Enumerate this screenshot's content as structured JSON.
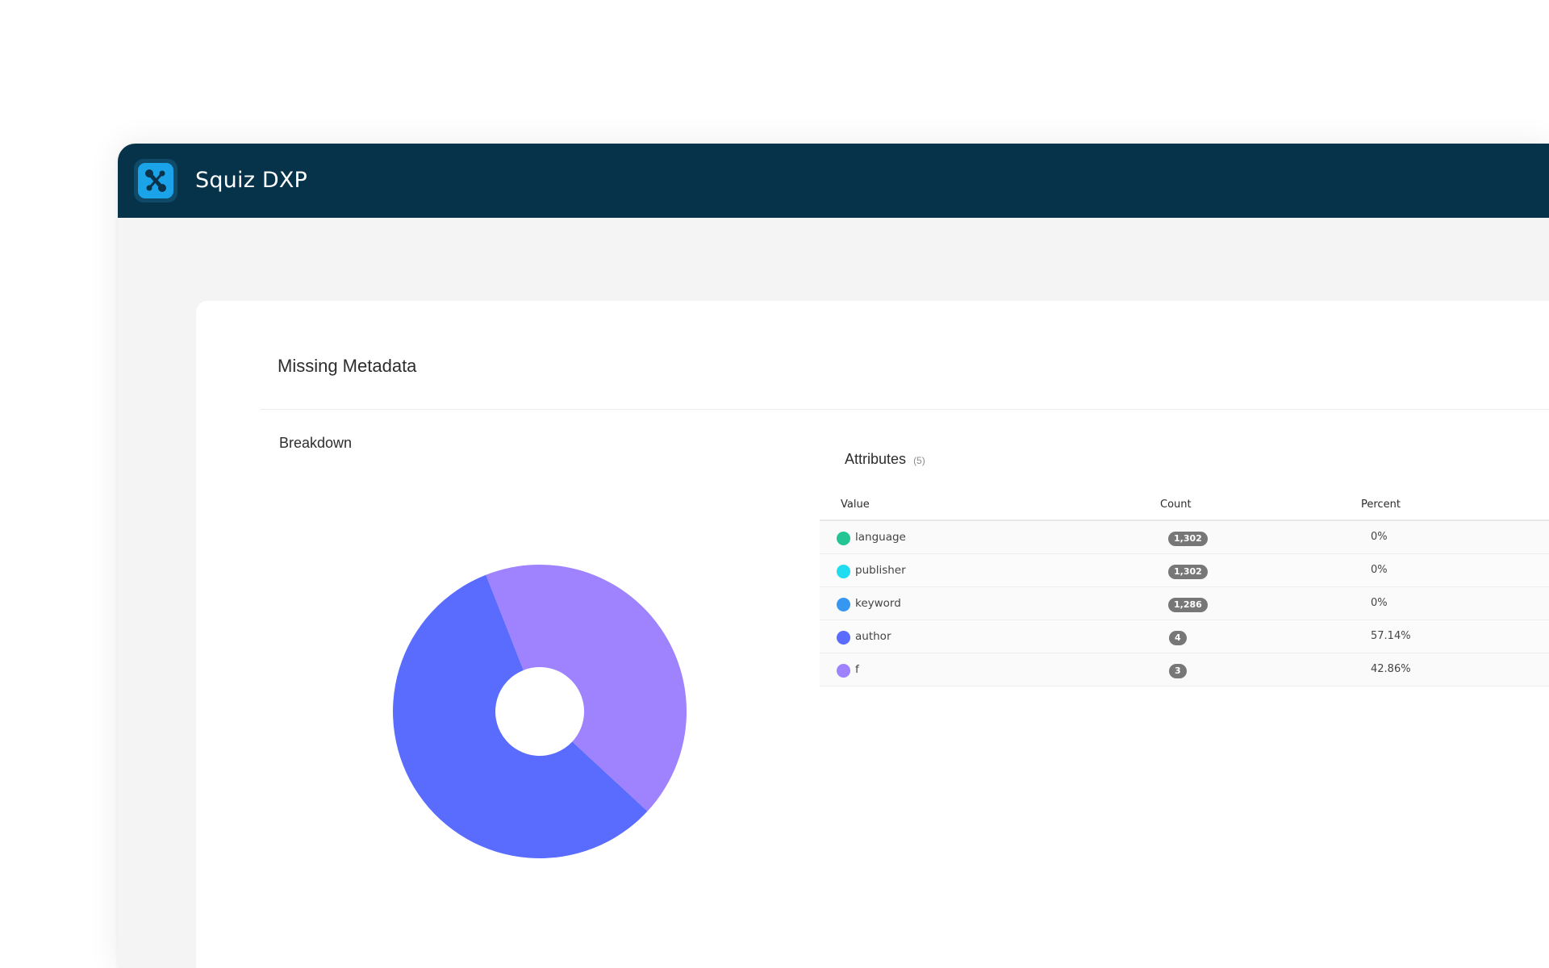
{
  "app": {
    "title": "Squiz DXP"
  },
  "colors": {
    "header_bg": "#063349",
    "logo_blue": "#1ba3ea",
    "logo_dark": "#0a3248"
  },
  "card": {
    "title": "Missing Metadata",
    "breakdown_label": "Breakdown"
  },
  "attributes": {
    "heading": "Attributes",
    "count_label": "(5)",
    "columns": {
      "value": "Value",
      "count": "Count",
      "percent": "Percent"
    },
    "rows": [
      {
        "value": "language",
        "count": "1,302",
        "percent": "0%",
        "color": "#22c593"
      },
      {
        "value": "publisher",
        "count": "1,302",
        "percent": "0%",
        "color": "#1fdcf0"
      },
      {
        "value": "keyword",
        "count": "1,286",
        "percent": "0%",
        "color": "#3597f2"
      },
      {
        "value": "author",
        "count": "4",
        "percent": "57.14%",
        "color": "#5a6cfe"
      },
      {
        "value": "f",
        "count": "3",
        "percent": "42.86%",
        "color": "#9e82fe"
      }
    ]
  },
  "chart_data": {
    "type": "pie",
    "donut": true,
    "categories": [
      "language",
      "publisher",
      "keyword",
      "author",
      "f"
    ],
    "values": [
      0,
      0,
      0,
      57.14,
      42.86
    ],
    "colors": [
      "#22c593",
      "#1fdcf0",
      "#3597f2",
      "#5a6cfe",
      "#9e82fe"
    ],
    "title": "",
    "legend": "none"
  }
}
